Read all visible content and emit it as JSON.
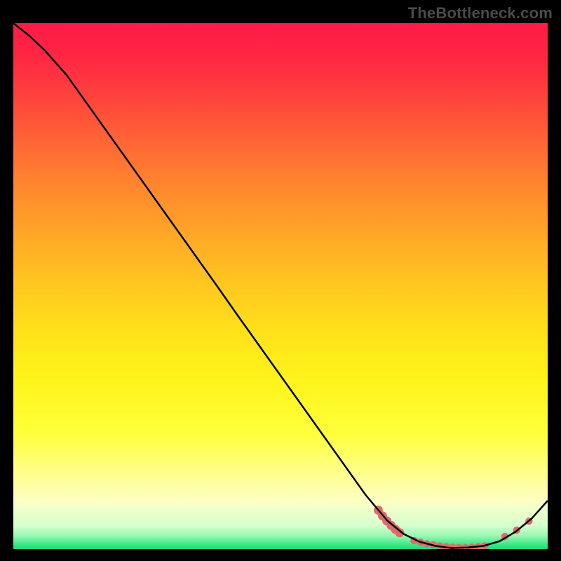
{
  "watermark": "TheBottleneck.com",
  "chart_data": {
    "type": "line",
    "xlim": [
      0,
      100
    ],
    "ylim": [
      0,
      100
    ],
    "xlabel": "",
    "ylabel": "",
    "title": "",
    "grid": false,
    "background_gradient": {
      "stops": [
        {
          "offset": 0.0,
          "color": "#ff1b46"
        },
        {
          "offset": 0.05,
          "color": "#ff2344"
        },
        {
          "offset": 0.1,
          "color": "#ff3340"
        },
        {
          "offset": 0.17,
          "color": "#ff4f3a"
        },
        {
          "offset": 0.25,
          "color": "#ff6f33"
        },
        {
          "offset": 0.33,
          "color": "#ff8e2c"
        },
        {
          "offset": 0.42,
          "color": "#ffad26"
        },
        {
          "offset": 0.5,
          "color": "#ffc81f"
        },
        {
          "offset": 0.58,
          "color": "#ffe01a"
        },
        {
          "offset": 0.68,
          "color": "#fff41b"
        },
        {
          "offset": 0.78,
          "color": "#ffff3b"
        },
        {
          "offset": 0.85,
          "color": "#ffff86"
        },
        {
          "offset": 0.91,
          "color": "#fbffc4"
        },
        {
          "offset": 0.955,
          "color": "#d6ffcf"
        },
        {
          "offset": 0.974,
          "color": "#9cf9b4"
        },
        {
          "offset": 0.987,
          "color": "#55eb92"
        },
        {
          "offset": 1.0,
          "color": "#14dd78"
        }
      ]
    },
    "series": [
      {
        "name": "bottleneck-curve",
        "style": {
          "stroke": "#000000",
          "stroke_width": 2.5,
          "fill": "none"
        },
        "x": [
          0,
          3,
          6,
          10,
          14,
          18,
          22,
          26,
          30,
          34,
          38,
          42,
          46,
          50,
          54,
          58,
          62,
          66,
          70,
          73,
          76,
          79,
          82,
          85,
          88,
          91,
          94,
          97,
          100
        ],
        "y": [
          100.0,
          97.6,
          94.7,
          90.1,
          84.4,
          78.7,
          73.0,
          67.3,
          61.6,
          55.9,
          50.2,
          44.4,
          38.7,
          33.0,
          27.3,
          21.6,
          15.9,
          10.2,
          5.4,
          2.9,
          1.4,
          0.6,
          0.2,
          0.3,
          0.6,
          1.5,
          3.3,
          5.8,
          9.2
        ]
      }
    ],
    "markers": {
      "name": "highlight-dots",
      "style": {
        "fill": "#e06a6a",
        "radius_large": 6.5,
        "radius_small": 5.2
      },
      "points": [
        {
          "x": 68.3,
          "y": 7.4,
          "r": 6.5
        },
        {
          "x": 69.1,
          "y": 6.3,
          "r": 6.5
        },
        {
          "x": 69.9,
          "y": 5.35,
          "r": 6.5
        },
        {
          "x": 70.7,
          "y": 4.5,
          "r": 6.5
        },
        {
          "x": 71.5,
          "y": 3.75,
          "r": 6.5
        },
        {
          "x": 72.3,
          "y": 3.1,
          "r": 6.5
        },
        {
          "x": 75.0,
          "y": 1.6,
          "r": 5.2
        },
        {
          "x": 76.2,
          "y": 1.3,
          "r": 5.2
        },
        {
          "x": 77.4,
          "y": 1.0,
          "r": 5.2
        },
        {
          "x": 78.6,
          "y": 0.8,
          "r": 5.2
        },
        {
          "x": 79.8,
          "y": 0.6,
          "r": 5.2
        },
        {
          "x": 81.0,
          "y": 0.45,
          "r": 5.2
        },
        {
          "x": 82.2,
          "y": 0.35,
          "r": 5.2
        },
        {
          "x": 83.4,
          "y": 0.3,
          "r": 5.2
        },
        {
          "x": 84.6,
          "y": 0.3,
          "r": 5.2
        },
        {
          "x": 85.8,
          "y": 0.35,
          "r": 5.2
        },
        {
          "x": 87.0,
          "y": 0.45,
          "r": 5.2
        },
        {
          "x": 88.2,
          "y": 0.6,
          "r": 5.2
        },
        {
          "x": 92.0,
          "y": 2.4,
          "r": 5.2
        },
        {
          "x": 94.2,
          "y": 3.6,
          "r": 5.2
        },
        {
          "x": 96.5,
          "y": 5.3,
          "r": 5.2
        }
      ]
    }
  }
}
